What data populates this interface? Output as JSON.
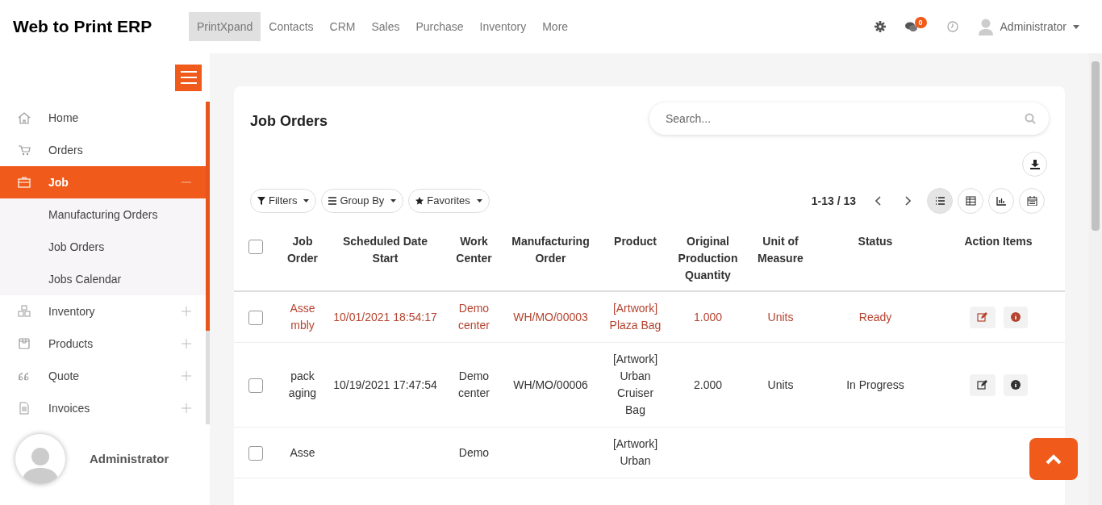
{
  "brand": "Web to Print ERP",
  "top_menu": [
    {
      "label": "PrintXpand",
      "selected": true
    },
    {
      "label": "Contacts",
      "selected": false
    },
    {
      "label": "CRM",
      "selected": false
    },
    {
      "label": "Sales",
      "selected": false
    },
    {
      "label": "Purchase",
      "selected": false
    },
    {
      "label": "Inventory",
      "selected": false
    },
    {
      "label": "More",
      "selected": false
    }
  ],
  "messages_badge": "0",
  "user_menu": "Administrator",
  "sidebar": {
    "items": [
      {
        "label": "Home",
        "kind": "home",
        "selected": false
      },
      {
        "label": "Orders",
        "kind": "cart",
        "selected": false
      },
      {
        "label": "Job",
        "kind": "briefcase",
        "selected": true,
        "expanded": true,
        "children": [
          {
            "label": "Manufacturing Orders"
          },
          {
            "label": "Job Orders"
          },
          {
            "label": "Jobs Calendar"
          }
        ]
      },
      {
        "label": "Inventory",
        "kind": "boxes",
        "selected": false,
        "expanded": false
      },
      {
        "label": "Products",
        "kind": "package",
        "selected": false,
        "expanded": false
      },
      {
        "label": "Quote",
        "kind": "quote",
        "selected": false,
        "expanded": false
      },
      {
        "label": "Invoices",
        "kind": "document",
        "selected": false,
        "expanded": false
      }
    ],
    "user": "Administrator"
  },
  "page": {
    "title": "Job Orders",
    "search": {
      "placeholder": "Search..."
    },
    "filters": [
      {
        "label": "Filters",
        "kind": "filter"
      },
      {
        "label": "Group By",
        "kind": "group"
      },
      {
        "label": "Favorites",
        "kind": "favorite"
      }
    ],
    "pager": "1-13 / 13",
    "views": [
      {
        "kind": "list",
        "selected": true
      },
      {
        "kind": "pivot",
        "selected": false
      },
      {
        "kind": "graph",
        "selected": false
      },
      {
        "kind": "calendar",
        "selected": false
      }
    ]
  },
  "table": {
    "select_all": {
      "checked": false
    },
    "columns": [
      "Job Order",
      "Scheduled Date Start",
      "Work Center",
      "Manufacturing Order",
      "Product",
      "Original Production Quantity",
      "Unit of Measure",
      "Status",
      "Action Items"
    ],
    "rows": [
      {
        "color": "#b5432f",
        "checked": false,
        "cells": [
          "Assembly",
          "10/01/2021 18:54:17",
          "Demo center",
          "WH/MO/00003",
          "[Artwork] Plaza Bag",
          "1.000",
          "Units",
          "Ready"
        ]
      },
      {
        "color": "#333333",
        "checked": false,
        "cells": [
          "packaging",
          "10/19/2021 17:47:54",
          "Demo center",
          "WH/MO/00006",
          "[Artwork] Urban Cruiser Bag",
          "2.000",
          "Units",
          "In Progress"
        ]
      },
      {
        "color": "#333333",
        "checked": false,
        "cells": [
          "Asse",
          "",
          "Demo",
          "",
          "[Artwork] Urban",
          "",
          "",
          ""
        ]
      }
    ]
  }
}
